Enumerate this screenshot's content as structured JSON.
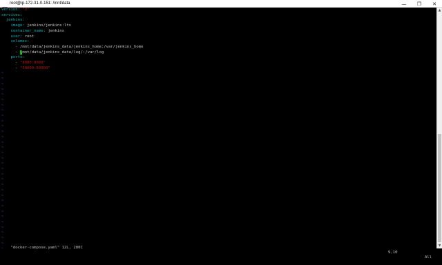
{
  "window": {
    "title": "root@ip-172-31-0-151: /mnt/data",
    "controls": {
      "minimize": "—",
      "maximize": "❐",
      "close": "✕"
    }
  },
  "editor": {
    "lines": [
      {
        "key": "version:",
        "value": "\"3\""
      },
      {
        "key": "services:"
      },
      {
        "key": "  jenkins:"
      },
      {
        "key": "    image:",
        "value": "jenkins/jenkins:lts"
      },
      {
        "key": "    container_name:",
        "value": "jenkins"
      },
      {
        "key": "    user:",
        "value": "root"
      },
      {
        "key": "    volumes:"
      },
      {
        "dash": "      - ",
        "value": "/mnt/data/jenkins_data/jenkins_home:/var/jenkins_home"
      },
      {
        "dash": "      - ",
        "cursor_char": "/",
        "value": "mnt/data/jenkins_data/log/:/var/log"
      },
      {
        "key": "    ports:"
      },
      {
        "dash": "      - ",
        "value": "\"8080:8080\""
      },
      {
        "dash": "      - ",
        "value": "\"50000:50000\""
      }
    ],
    "tilde": "~",
    "tilde_count": 34
  },
  "status": {
    "file_info": "\"docker-compose.yaml\" 12L, 280C",
    "position": "9,10",
    "percent": "All"
  },
  "colors": {
    "key": "#14b0b0",
    "string": "#b31818",
    "tilde": "#3f3fd0",
    "cursor": "#19d819"
  }
}
